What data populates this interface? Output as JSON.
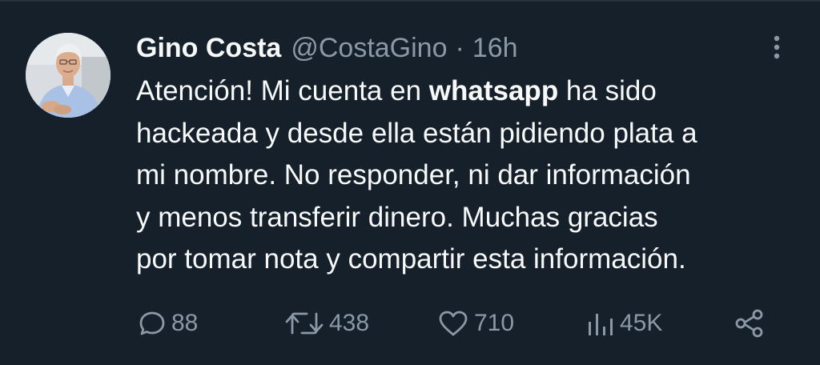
{
  "tweet": {
    "author_name": "Gino Costa",
    "author_handle": "@CostaGino",
    "separator": "·",
    "timestamp": "16h",
    "body_lines": [
      {
        "before": "Atención! Mi cuenta en ",
        "bold": "whatsapp",
        "after": " ha sido"
      },
      {
        "text": "hackeada y desde ella están pidiendo plata a"
      },
      {
        "text": "mi nombre. No responder, ni dar información"
      },
      {
        "text": "y menos transferir dinero. Muchas gracias"
      },
      {
        "text": "por tomar nota y compartir esta información."
      }
    ]
  },
  "actions": {
    "replies": "88",
    "retweets": "438",
    "likes": "710",
    "views": "45K"
  },
  "icons": {
    "more": "more-vertical-icon",
    "reply": "speech-bubble-icon",
    "retweet": "retweet-arrows-icon",
    "like": "heart-icon",
    "views": "bar-chart-icon",
    "share": "share-nodes-icon"
  },
  "colors": {
    "background": "#15202b",
    "primary_text": "#f7f9f9",
    "secondary_text": "#8b98a5"
  }
}
